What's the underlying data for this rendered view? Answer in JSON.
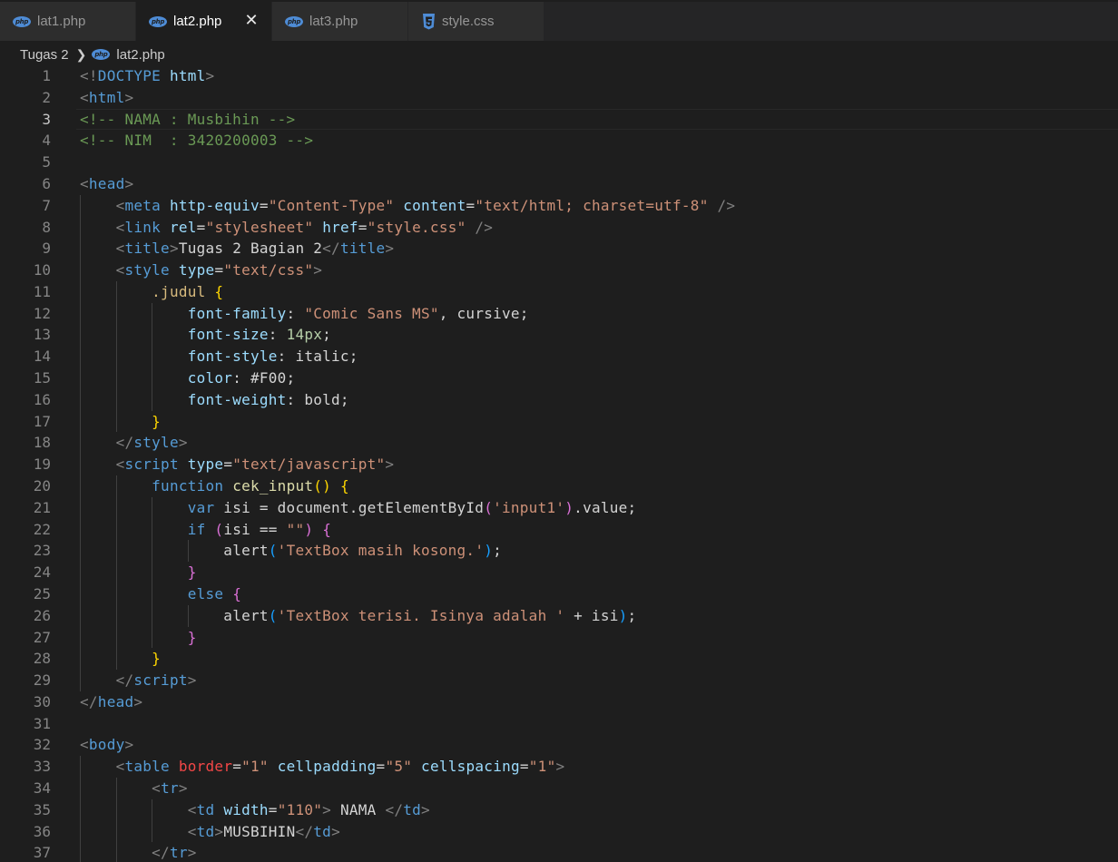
{
  "tabs": [
    {
      "label": "lat1.php",
      "icon": "php-icon",
      "active": false
    },
    {
      "label": "lat2.php",
      "icon": "php-icon",
      "active": true
    },
    {
      "label": "lat3.php",
      "icon": "php-icon",
      "active": false
    },
    {
      "label": "style.css",
      "icon": "css-icon",
      "active": false
    }
  ],
  "breadcrumb": {
    "folder": "Tugas 2",
    "file": "lat2.php"
  },
  "current_line": 3,
  "colors": {
    "background": "#1e1e1e",
    "tag_bracket": "#808080",
    "tag_name": "#569cd6",
    "attribute": "#9cdcfe",
    "string": "#ce9178",
    "comment": "#6a9955",
    "text": "#d4d4d4",
    "keyword": "#569cd6",
    "control": "#c586c0",
    "function": "#dcdcaa",
    "selector": "#d7ba7d",
    "number": "#b5cea8",
    "variable": "#9cdcfe",
    "bracket_1": "#ffd700",
    "bracket_2": "#da70d6",
    "bracket_3": "#179fff",
    "error": "#f44747",
    "line_number": "#858585",
    "line_number_active": "#c6c6c6"
  },
  "code_lines": [
    {
      "n": "1",
      "tokens": [
        [
          "<!",
          "p"
        ],
        [
          "DOCTYPE",
          "tag"
        ],
        [
          " ",
          "t"
        ],
        [
          "html",
          "attr"
        ],
        [
          ">",
          "p"
        ]
      ]
    },
    {
      "n": "2",
      "tokens": [
        [
          "<",
          "p"
        ],
        [
          "html",
          "tag"
        ],
        [
          ">",
          "p"
        ]
      ]
    },
    {
      "n": "3",
      "tokens": [
        [
          "<!-- NAMA : Musbihin -->",
          "cmt"
        ]
      ]
    },
    {
      "n": "4",
      "tokens": [
        [
          "<!-- NIM  : 3420200003 -->",
          "cmt"
        ]
      ]
    },
    {
      "n": "5",
      "tokens": []
    },
    {
      "n": "6",
      "tokens": [
        [
          "<",
          "p"
        ],
        [
          "head",
          "tag"
        ],
        [
          ">",
          "p"
        ]
      ]
    },
    {
      "n": "7",
      "tokens": [
        [
          "    ",
          "t"
        ],
        [
          "<",
          "p"
        ],
        [
          "meta",
          "tag"
        ],
        [
          " ",
          "t"
        ],
        [
          "http-equiv",
          "attr"
        ],
        [
          "=",
          "t"
        ],
        [
          "\"Content-Type\"",
          "str"
        ],
        [
          " ",
          "t"
        ],
        [
          "content",
          "attr"
        ],
        [
          "=",
          "t"
        ],
        [
          "\"text/html; charset=utf-8\"",
          "str"
        ],
        [
          " ",
          "t"
        ],
        [
          "/>",
          "p"
        ]
      ]
    },
    {
      "n": "8",
      "tokens": [
        [
          "    ",
          "t"
        ],
        [
          "<",
          "p"
        ],
        [
          "link",
          "tag"
        ],
        [
          " ",
          "t"
        ],
        [
          "rel",
          "attr"
        ],
        [
          "=",
          "t"
        ],
        [
          "\"stylesheet\"",
          "str"
        ],
        [
          " ",
          "t"
        ],
        [
          "href",
          "attr"
        ],
        [
          "=",
          "t"
        ],
        [
          "\"style.css\"",
          "str"
        ],
        [
          " ",
          "t"
        ],
        [
          "/>",
          "p"
        ]
      ]
    },
    {
      "n": "9",
      "tokens": [
        [
          "    ",
          "t"
        ],
        [
          "<",
          "p"
        ],
        [
          "title",
          "tag"
        ],
        [
          ">",
          "p"
        ],
        [
          "Tugas 2 Bagian 2",
          "t"
        ],
        [
          "</",
          "p"
        ],
        [
          "title",
          "tag"
        ],
        [
          ">",
          "p"
        ]
      ]
    },
    {
      "n": "10",
      "tokens": [
        [
          "    ",
          "t"
        ],
        [
          "<",
          "p"
        ],
        [
          "style",
          "tag"
        ],
        [
          " ",
          "t"
        ],
        [
          "type",
          "attr"
        ],
        [
          "=",
          "t"
        ],
        [
          "\"text/css\"",
          "str"
        ],
        [
          ">",
          "p"
        ]
      ]
    },
    {
      "n": "11",
      "tokens": [
        [
          "        ",
          "t"
        ],
        [
          ".judul",
          "sel"
        ],
        [
          " ",
          "t"
        ],
        [
          "{",
          "b1"
        ]
      ]
    },
    {
      "n": "12",
      "tokens": [
        [
          "            ",
          "t"
        ],
        [
          "font-family",
          "attr"
        ],
        [
          ": ",
          "t"
        ],
        [
          "\"Comic Sans MS\"",
          "str"
        ],
        [
          ", cursive;",
          "t"
        ]
      ]
    },
    {
      "n": "13",
      "tokens": [
        [
          "            ",
          "t"
        ],
        [
          "font-size",
          "attr"
        ],
        [
          ": ",
          "t"
        ],
        [
          "14px",
          "num"
        ],
        [
          ";",
          "t"
        ]
      ]
    },
    {
      "n": "14",
      "tokens": [
        [
          "            ",
          "t"
        ],
        [
          "font-style",
          "attr"
        ],
        [
          ": italic;",
          "t"
        ]
      ]
    },
    {
      "n": "15",
      "tokens": [
        [
          "            ",
          "t"
        ],
        [
          "color",
          "attr"
        ],
        [
          ": #F00;",
          "t"
        ]
      ]
    },
    {
      "n": "16",
      "tokens": [
        [
          "            ",
          "t"
        ],
        [
          "font-weight",
          "attr"
        ],
        [
          ": bold;",
          "t"
        ]
      ]
    },
    {
      "n": "17",
      "tokens": [
        [
          "        ",
          "t"
        ],
        [
          "}",
          "b1"
        ]
      ]
    },
    {
      "n": "18",
      "tokens": [
        [
          "    ",
          "t"
        ],
        [
          "</",
          "p"
        ],
        [
          "style",
          "tag"
        ],
        [
          ">",
          "p"
        ]
      ]
    },
    {
      "n": "19",
      "tokens": [
        [
          "    ",
          "t"
        ],
        [
          "<",
          "p"
        ],
        [
          "script",
          "tag"
        ],
        [
          " ",
          "t"
        ],
        [
          "type",
          "attr"
        ],
        [
          "=",
          "t"
        ],
        [
          "\"text/javascript\"",
          "str"
        ],
        [
          ">",
          "p"
        ]
      ]
    },
    {
      "n": "20",
      "tokens": [
        [
          "        ",
          "t"
        ],
        [
          "function",
          "kw"
        ],
        [
          " ",
          "t"
        ],
        [
          "cek_input",
          "fn"
        ],
        [
          "()",
          "b1"
        ],
        [
          " ",
          "t"
        ],
        [
          "{",
          "b1"
        ]
      ]
    },
    {
      "n": "21",
      "tokens": [
        [
          "            ",
          "t"
        ],
        [
          "var",
          "kw"
        ],
        [
          " isi = document.getElementById",
          "t"
        ],
        [
          "(",
          "b2"
        ],
        [
          "'input1'",
          "str"
        ],
        [
          ")",
          "b2"
        ],
        [
          ".value;",
          "t"
        ]
      ]
    },
    {
      "n": "22",
      "tokens": [
        [
          "            ",
          "t"
        ],
        [
          "if",
          "kw"
        ],
        [
          " ",
          "t"
        ],
        [
          "(",
          "b2"
        ],
        [
          "isi == ",
          "t"
        ],
        [
          "\"\"",
          "str"
        ],
        [
          ")",
          "b2"
        ],
        [
          " ",
          "t"
        ],
        [
          "{",
          "b2"
        ]
      ]
    },
    {
      "n": "23",
      "tokens": [
        [
          "                ",
          "t"
        ],
        [
          "alert",
          "t"
        ],
        [
          "(",
          "b3"
        ],
        [
          "'TextBox masih kosong.'",
          "str"
        ],
        [
          ")",
          "b3"
        ],
        [
          ";",
          "t"
        ]
      ]
    },
    {
      "n": "24",
      "tokens": [
        [
          "            ",
          "t"
        ],
        [
          "}",
          "b2"
        ]
      ]
    },
    {
      "n": "25",
      "tokens": [
        [
          "            ",
          "t"
        ],
        [
          "else",
          "kw"
        ],
        [
          " ",
          "t"
        ],
        [
          "{",
          "b2"
        ]
      ]
    },
    {
      "n": "26",
      "tokens": [
        [
          "                ",
          "t"
        ],
        [
          "alert",
          "t"
        ],
        [
          "(",
          "b3"
        ],
        [
          "'TextBox terisi. Isinya adalah '",
          "str"
        ],
        [
          " + isi",
          "t"
        ],
        [
          ")",
          "b3"
        ],
        [
          ";",
          "t"
        ]
      ]
    },
    {
      "n": "27",
      "tokens": [
        [
          "            ",
          "t"
        ],
        [
          "}",
          "b2"
        ]
      ]
    },
    {
      "n": "28",
      "tokens": [
        [
          "        ",
          "t"
        ],
        [
          "}",
          "b1"
        ]
      ]
    },
    {
      "n": "29",
      "tokens": [
        [
          "    ",
          "t"
        ],
        [
          "</",
          "p"
        ],
        [
          "script",
          "tag"
        ],
        [
          ">",
          "p"
        ]
      ]
    },
    {
      "n": "30",
      "tokens": [
        [
          "</",
          "p"
        ],
        [
          "head",
          "tag"
        ],
        [
          ">",
          "p"
        ]
      ]
    },
    {
      "n": "31",
      "tokens": []
    },
    {
      "n": "32",
      "tokens": [
        [
          "<",
          "p"
        ],
        [
          "body",
          "tag"
        ],
        [
          ">",
          "p"
        ]
      ]
    },
    {
      "n": "33",
      "tokens": [
        [
          "    ",
          "t"
        ],
        [
          "<",
          "p"
        ],
        [
          "table",
          "tag"
        ],
        [
          " ",
          "t"
        ],
        [
          "border",
          "err"
        ],
        [
          "=",
          "t"
        ],
        [
          "\"1\"",
          "str"
        ],
        [
          " ",
          "t"
        ],
        [
          "cellpadding",
          "attr"
        ],
        [
          "=",
          "t"
        ],
        [
          "\"5\"",
          "str"
        ],
        [
          " ",
          "t"
        ],
        [
          "cellspacing",
          "attr"
        ],
        [
          "=",
          "t"
        ],
        [
          "\"1\"",
          "str"
        ],
        [
          ">",
          "p"
        ]
      ]
    },
    {
      "n": "34",
      "tokens": [
        [
          "        ",
          "t"
        ],
        [
          "<",
          "p"
        ],
        [
          "tr",
          "tag"
        ],
        [
          ">",
          "p"
        ]
      ]
    },
    {
      "n": "35",
      "tokens": [
        [
          "            ",
          "t"
        ],
        [
          "<",
          "p"
        ],
        [
          "td",
          "tag"
        ],
        [
          " ",
          "t"
        ],
        [
          "width",
          "attr"
        ],
        [
          "=",
          "t"
        ],
        [
          "\"110\"",
          "str"
        ],
        [
          ">",
          "p"
        ],
        [
          " NAMA ",
          "t"
        ],
        [
          "</",
          "p"
        ],
        [
          "td",
          "tag"
        ],
        [
          ">",
          "p"
        ]
      ]
    },
    {
      "n": "36",
      "tokens": [
        [
          "            ",
          "t"
        ],
        [
          "<",
          "p"
        ],
        [
          "td",
          "tag"
        ],
        [
          ">",
          "p"
        ],
        [
          "MUSBIHIN",
          "t"
        ],
        [
          "</",
          "p"
        ],
        [
          "td",
          "tag"
        ],
        [
          ">",
          "p"
        ]
      ]
    },
    {
      "n": "37",
      "tokens": [
        [
          "        ",
          "t"
        ],
        [
          "</",
          "p"
        ],
        [
          "tr",
          "tag"
        ],
        [
          ">",
          "p"
        ]
      ]
    }
  ]
}
